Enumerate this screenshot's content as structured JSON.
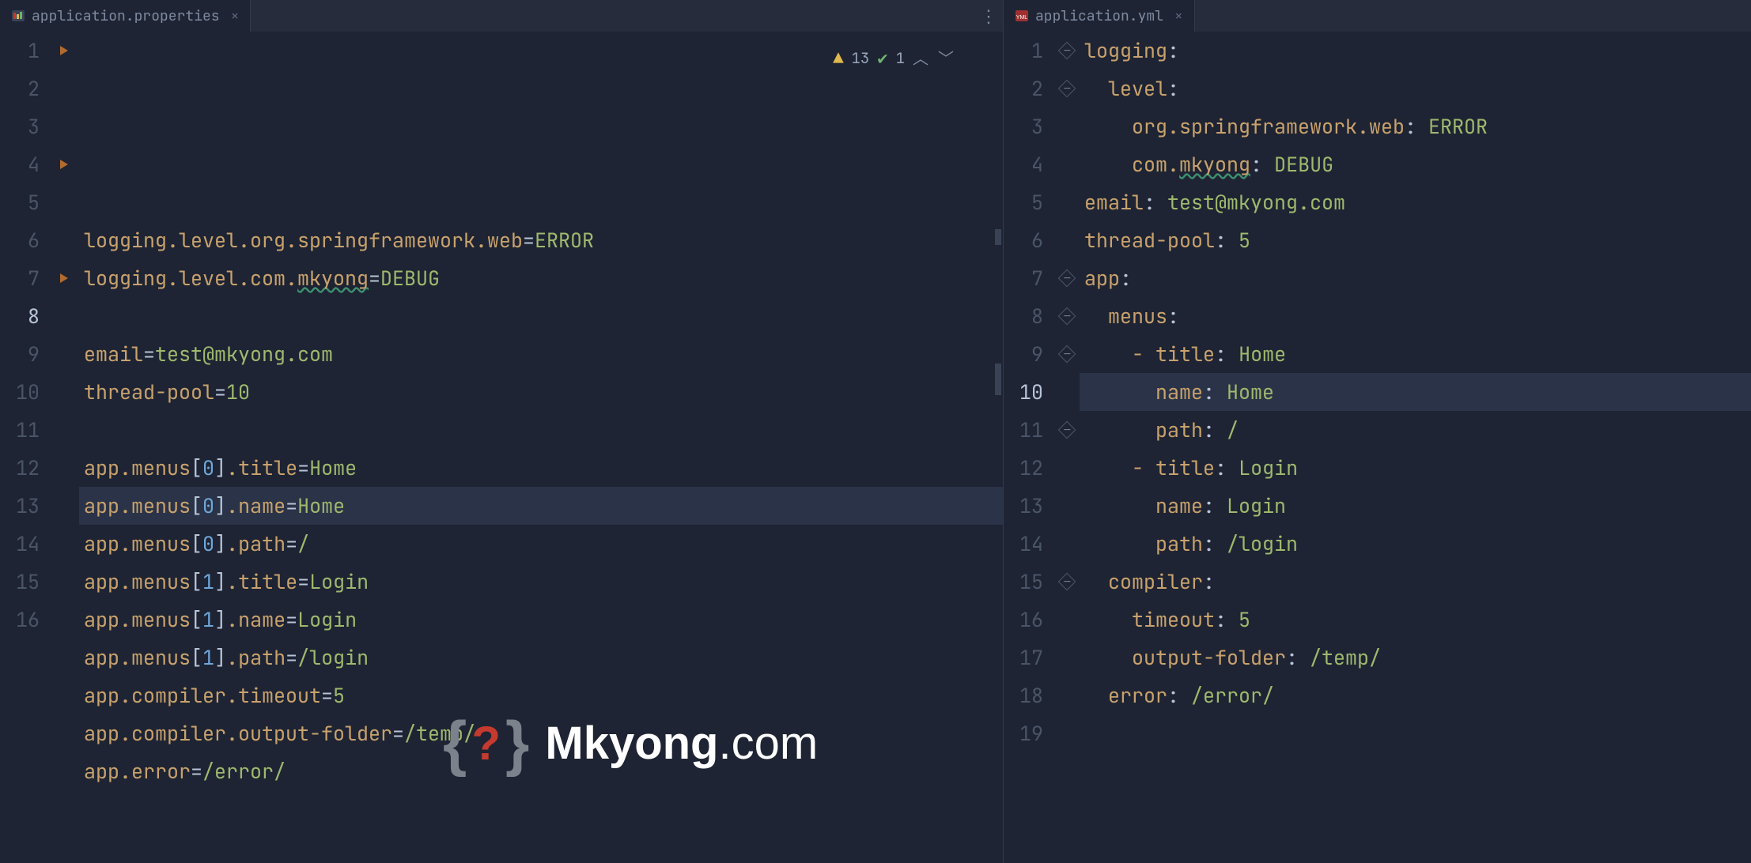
{
  "leftTab": {
    "filename": "application.properties"
  },
  "rightTab": {
    "filename": "application.yml"
  },
  "inspections": {
    "warnings": "13",
    "checks": "1"
  },
  "watermark": {
    "brand_bold": "Mkyong",
    "brand_rest": ".com"
  },
  "leftLines": {
    "count": 16,
    "current": 8,
    "tokens": [
      [
        [
          "key",
          "logging.level.org.springframework.web"
        ],
        [
          "punct",
          "="
        ],
        [
          "val",
          "ERROR"
        ]
      ],
      [
        [
          "key",
          "logging.level.com."
        ],
        [
          "key wavy",
          "mkyong"
        ],
        [
          "punct",
          "="
        ],
        [
          "val",
          "DEBUG"
        ]
      ],
      [],
      [
        [
          "key",
          "email"
        ],
        [
          "punct",
          "="
        ],
        [
          "val",
          "test@mkyong.com"
        ]
      ],
      [
        [
          "key",
          "thread-pool"
        ],
        [
          "punct",
          "="
        ],
        [
          "val",
          "10"
        ]
      ],
      [],
      [
        [
          "key",
          "app.menus"
        ],
        [
          "sq",
          "["
        ],
        [
          "num",
          "0"
        ],
        [
          "sq",
          "]"
        ],
        [
          "key",
          ".title"
        ],
        [
          "punct",
          "="
        ],
        [
          "val",
          "Home"
        ]
      ],
      [
        [
          "key",
          "app.menus"
        ],
        [
          "sq",
          "["
        ],
        [
          "num",
          "0"
        ],
        [
          "sq",
          "]"
        ],
        [
          "key",
          ".name"
        ],
        [
          "punct",
          "="
        ],
        [
          "val",
          "Home"
        ]
      ],
      [
        [
          "key",
          "app.menus"
        ],
        [
          "sq",
          "["
        ],
        [
          "num",
          "0"
        ],
        [
          "sq",
          "]"
        ],
        [
          "key",
          ".path"
        ],
        [
          "punct",
          "="
        ],
        [
          "val",
          "/"
        ]
      ],
      [
        [
          "key",
          "app.menus"
        ],
        [
          "sq",
          "["
        ],
        [
          "num",
          "1"
        ],
        [
          "sq",
          "]"
        ],
        [
          "key",
          ".title"
        ],
        [
          "punct",
          "="
        ],
        [
          "val",
          "Login"
        ]
      ],
      [
        [
          "key",
          "app.menus"
        ],
        [
          "sq",
          "["
        ],
        [
          "num",
          "1"
        ],
        [
          "sq",
          "]"
        ],
        [
          "key",
          ".name"
        ],
        [
          "punct",
          "="
        ],
        [
          "val",
          "Login"
        ]
      ],
      [
        [
          "key",
          "app.menus"
        ],
        [
          "sq",
          "["
        ],
        [
          "num",
          "1"
        ],
        [
          "sq",
          "]"
        ],
        [
          "key",
          ".path"
        ],
        [
          "punct",
          "="
        ],
        [
          "val",
          "/login"
        ]
      ],
      [
        [
          "key",
          "app.compiler.timeout"
        ],
        [
          "punct",
          "="
        ],
        [
          "val",
          "5"
        ]
      ],
      [
        [
          "key",
          "app.compiler.output-folder"
        ],
        [
          "punct",
          "="
        ],
        [
          "val",
          "/temp/"
        ]
      ],
      [
        [
          "key",
          "app.error"
        ],
        [
          "punct",
          "="
        ],
        [
          "val",
          "/error/"
        ]
      ],
      []
    ]
  },
  "rightLines": {
    "count": 19,
    "current": 10,
    "tokens": [
      [
        [
          "key",
          "logging"
        ],
        [
          "punct",
          ":"
        ]
      ],
      [
        [
          "pad",
          "  "
        ],
        [
          "key",
          "level"
        ],
        [
          "punct",
          ":"
        ]
      ],
      [
        [
          "pad",
          "    "
        ],
        [
          "key",
          "org.springframework.web"
        ],
        [
          "punct",
          ": "
        ],
        [
          "val",
          "ERROR"
        ]
      ],
      [
        [
          "pad",
          "    "
        ],
        [
          "key",
          "com."
        ],
        [
          "key wavy",
          "mkyong"
        ],
        [
          "punct",
          ": "
        ],
        [
          "val",
          "DEBUG"
        ]
      ],
      [
        [
          "key",
          "email"
        ],
        [
          "punct",
          ": "
        ],
        [
          "val",
          "test@mkyong.com"
        ]
      ],
      [
        [
          "key",
          "thread-pool"
        ],
        [
          "punct",
          ": "
        ],
        [
          "val",
          "5"
        ]
      ],
      [
        [
          "key",
          "app"
        ],
        [
          "punct",
          ":"
        ]
      ],
      [
        [
          "pad",
          "  "
        ],
        [
          "key",
          "menus"
        ],
        [
          "punct",
          ":"
        ]
      ],
      [
        [
          "pad",
          "    "
        ],
        [
          "dash",
          "- "
        ],
        [
          "key",
          "title"
        ],
        [
          "punct",
          ": "
        ],
        [
          "val",
          "Home"
        ]
      ],
      [
        [
          "pad",
          "      "
        ],
        [
          "key",
          "name"
        ],
        [
          "punct",
          ": "
        ],
        [
          "val",
          "Home"
        ]
      ],
      [
        [
          "pad",
          "      "
        ],
        [
          "key",
          "path"
        ],
        [
          "punct",
          ": "
        ],
        [
          "val",
          "/"
        ]
      ],
      [
        [
          "pad",
          "    "
        ],
        [
          "dash",
          "- "
        ],
        [
          "key",
          "title"
        ],
        [
          "punct",
          ": "
        ],
        [
          "val",
          "Login"
        ]
      ],
      [
        [
          "pad",
          "      "
        ],
        [
          "key",
          "name"
        ],
        [
          "punct",
          ": "
        ],
        [
          "val",
          "Login"
        ]
      ],
      [
        [
          "pad",
          "      "
        ],
        [
          "key",
          "path"
        ],
        [
          "punct",
          ": "
        ],
        [
          "val",
          "/login"
        ]
      ],
      [
        [
          "pad",
          "  "
        ],
        [
          "key",
          "compiler"
        ],
        [
          "punct",
          ":"
        ]
      ],
      [
        [
          "pad",
          "    "
        ],
        [
          "key",
          "timeout"
        ],
        [
          "punct",
          ": "
        ],
        [
          "val",
          "5"
        ]
      ],
      [
        [
          "pad",
          "    "
        ],
        [
          "key",
          "output-folder"
        ],
        [
          "punct",
          ": "
        ],
        [
          "val",
          "/temp/"
        ]
      ],
      [
        [
          "pad",
          "  "
        ],
        [
          "key",
          "error"
        ],
        [
          "punct",
          ": "
        ],
        [
          "val",
          "/error/"
        ]
      ],
      []
    ]
  },
  "leftSectionMarks": [
    1,
    4,
    7
  ],
  "rightFolds": [
    1,
    2,
    7,
    8,
    9,
    11,
    15
  ]
}
